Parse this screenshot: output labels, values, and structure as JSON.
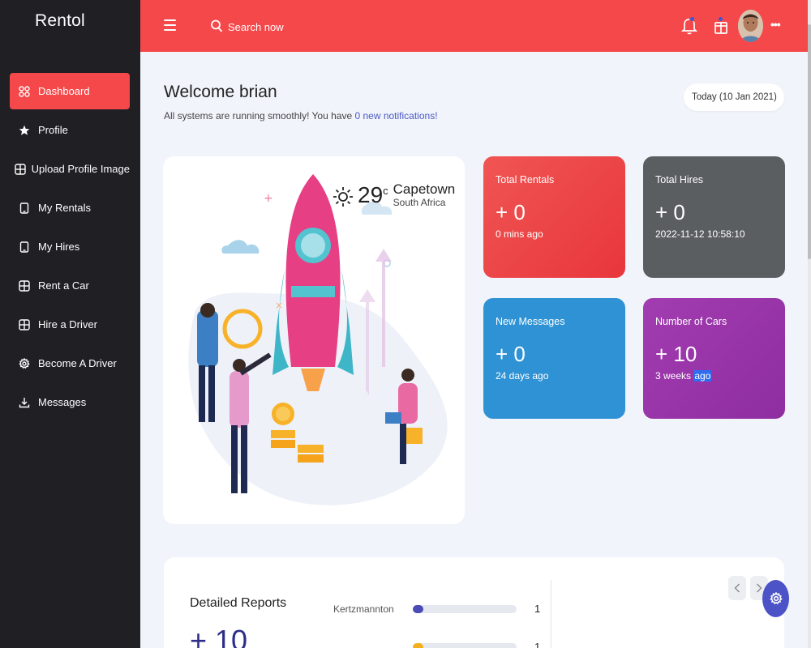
{
  "app": {
    "brand": "Rentol"
  },
  "sidebar": {
    "items": [
      {
        "label": "Dashboard",
        "icon": "grid-icon",
        "active": true
      },
      {
        "label": "Profile",
        "icon": "star-icon"
      },
      {
        "label": "Upload Profile Image",
        "icon": "plus-square-icon"
      },
      {
        "label": "My Rentals",
        "icon": "tablet-icon"
      },
      {
        "label": "My Hires",
        "icon": "tablet-icon"
      },
      {
        "label": "Rent a Car",
        "icon": "plus-square-icon"
      },
      {
        "label": "Hire a Driver",
        "icon": "plus-square-icon"
      },
      {
        "label": "Become A Driver",
        "icon": "gear-icon"
      },
      {
        "label": "Messages",
        "icon": "download-icon"
      }
    ]
  },
  "topbar": {
    "search_placeholder": "Search now",
    "icons": [
      "menu-icon",
      "search-icon",
      "bell-icon",
      "gift-icon",
      "avatar",
      "more-icon"
    ]
  },
  "welcome": {
    "title": "Welcome brian",
    "subtitle_prefix": "All systems are running smoothly! You have ",
    "notifications_link": "0 new notifications!",
    "date_filter": "Today (10 Jan 2021)"
  },
  "weather": {
    "temp": "29",
    "unit": "c",
    "city": "Capetown",
    "country": "South Africa"
  },
  "stats": {
    "rentals": {
      "title": "Total Rentals",
      "value": "+ 0",
      "sub": "0 mins ago"
    },
    "hires": {
      "title": "Total Hires",
      "value": "+ 0",
      "sub": "2022-11-12 10:58:10"
    },
    "messages": {
      "title": "New Messages",
      "value": "+ 0",
      "sub": "24 days ago"
    },
    "cars": {
      "title": "Number of Cars",
      "value": "+ 10",
      "sub_prefix": "3 weeks ",
      "sub_highlight": "ago"
    }
  },
  "reports": {
    "title": "Detailed Reports",
    "big_value": "+ 10",
    "rows": [
      {
        "name": "Kertzmannton",
        "value": "1",
        "fill": 0.1,
        "color": "#4b4bb5"
      },
      {
        "name": "",
        "value": "1",
        "fill": 0.1,
        "color": "#f2b01e"
      }
    ]
  },
  "colors": {
    "accent": "#f5484a",
    "sidebar": "#1f1f24",
    "primary": "#4b53c6"
  }
}
